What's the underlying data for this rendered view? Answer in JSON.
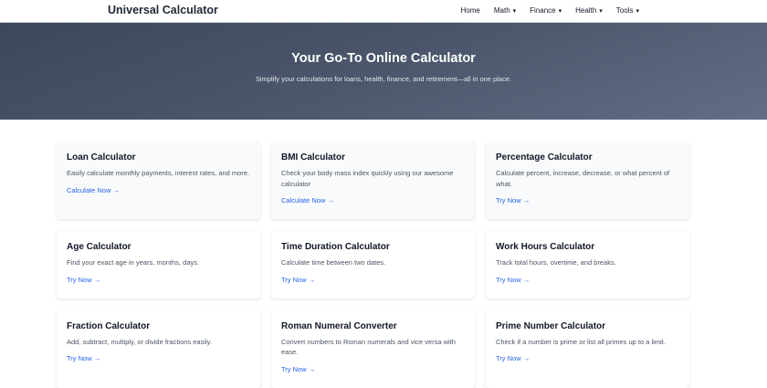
{
  "header": {
    "logo": "Universal Calculator",
    "nav": [
      {
        "label": "Home",
        "dropdown": false
      },
      {
        "label": "Math",
        "dropdown": true
      },
      {
        "label": "Finance",
        "dropdown": true
      },
      {
        "label": "Health",
        "dropdown": true
      },
      {
        "label": "Tools",
        "dropdown": true
      }
    ],
    "chevron": "⌄"
  },
  "hero": {
    "title": "Your Go-To Online Calculator",
    "subtitle": "Simplify your calculations for loans, health, finance, and retirement—all in one place."
  },
  "cards": [
    {
      "title": "Loan Calculator",
      "desc": "Easily calculate monthly payments, interest rates, and more.",
      "link": "Calculate Now →"
    },
    {
      "title": "BMI Calculator",
      "desc": "Check your body mass index quickly using our awesome calculator",
      "link": "Calculate Now →"
    },
    {
      "title": "Percentage Calculator",
      "desc": "Calculate percent, increase, decrease, or what percent of what.",
      "link": "Try Now →"
    },
    {
      "title": "Age Calculator",
      "desc": "Find your exact age in years, months, days.",
      "link": "Try Now →"
    },
    {
      "title": "Time Duration Calculator",
      "desc": "Calculate time between two dates.",
      "link": "Try Now →"
    },
    {
      "title": "Work Hours Calculator",
      "desc": "Track total hours, overtime, and breaks.",
      "link": "Try Now →"
    },
    {
      "title": "Fraction Calculator",
      "desc": "Add, subtract, multiply, or divide fractions easily.",
      "link": "Try Now →"
    },
    {
      "title": "Roman Numeral Converter",
      "desc": "Convert numbers to Roman numerals and vice versa with ease.",
      "link": "Try Now →"
    },
    {
      "title": "Prime Number Calculator",
      "desc": "Check if a number is prime or list all primes up to a limit.",
      "link": "Try Now →"
    }
  ]
}
